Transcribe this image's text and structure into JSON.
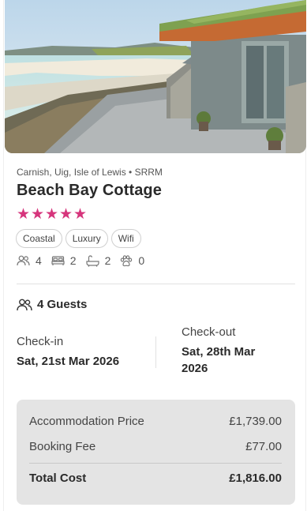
{
  "listing": {
    "location": "Carnish, Uig, Isle of Lewis • SRRM",
    "title": "Beach Bay Cottage",
    "rating": 5,
    "rating_max": 5,
    "tags": [
      "Coastal",
      "Luxury",
      "Wifi"
    ],
    "amenities": {
      "guests_icon": "people-icon",
      "guests": "4",
      "beds_icon": "bed-icon",
      "beds": "2",
      "baths_icon": "bath-icon",
      "baths": "2",
      "pets_icon": "paw-icon",
      "pets": "0"
    }
  },
  "booking": {
    "guests_label": "4 Guests",
    "checkin_label": "Check-in",
    "checkin_value": "Sat, 21st Mar 2026",
    "checkout_label": "Check-out",
    "checkout_value": "Sat, 28th Mar 2026"
  },
  "price": {
    "accommodation_label": "Accommodation Price",
    "accommodation_value": "£1,739.00",
    "fee_label": "Booking Fee",
    "fee_value": "£77.00",
    "total_label": "Total Cost",
    "total_value": "£1,816.00"
  },
  "colors": {
    "star": "#d6357c",
    "price_bg": "#e4e4e4"
  }
}
